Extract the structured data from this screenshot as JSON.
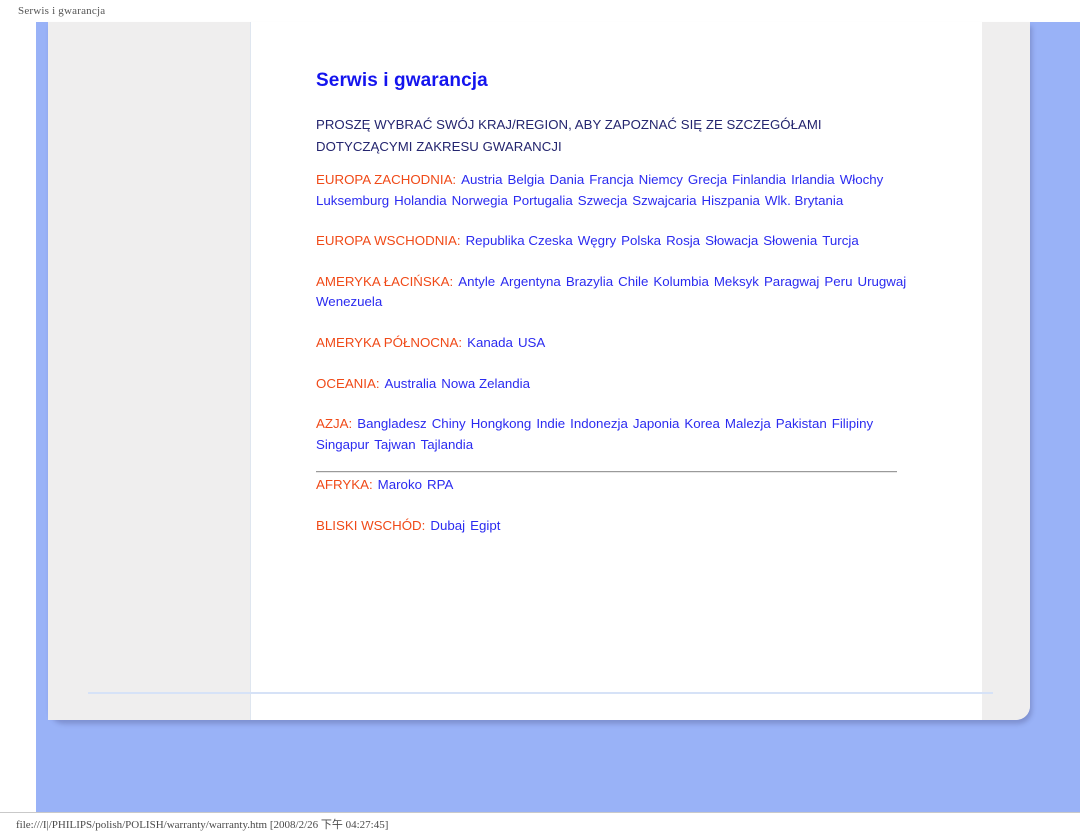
{
  "print_header": "Serwis i gwarancja",
  "document": {
    "title": "Serwis i gwarancja",
    "subtitle": "PROSZĘ WYBRAĆ SWÓJ KRAJ/REGION, ABY ZAPOZNAĆ SIĘ ZE SZCZEGÓŁAMI DOTYCZĄCYMI ZAKRESU GWARANCJI",
    "regions": [
      {
        "label": "EUROPA ZACHODNIA:",
        "countries": [
          "Austria",
          "Belgia",
          "Dania",
          "Francja",
          "Niemcy",
          "Grecja",
          "Finlandia",
          "Irlandia",
          "Włochy",
          "Luksemburg",
          "Holandia",
          "Norwegia",
          "Portugalia",
          "Szwecja",
          "Szwajcaria",
          "Hiszpania",
          "Wlk. Brytania"
        ]
      },
      {
        "label": "EUROPA WSCHODNIA:",
        "countries": [
          "Republika Czeska",
          "Węgry",
          "Polska",
          "Rosja",
          "Słowacja",
          "Słowenia",
          "Turcja"
        ]
      },
      {
        "label": "AMERYKA ŁACIŃSKA:",
        "countries": [
          "Antyle",
          "Argentyna",
          "Brazylia",
          "Chile",
          "Kolumbia",
          "Meksyk",
          "Paragwaj",
          "Peru",
          "Urugwaj",
          "Wenezuela"
        ]
      },
      {
        "label": "AMERYKA PÓŁNOCNA:",
        "countries": [
          "Kanada",
          "USA"
        ]
      },
      {
        "label": "OCEANIA:",
        "countries": [
          "Australia",
          "Nowa Zelandia"
        ]
      },
      {
        "label": "AZJA:",
        "countries": [
          "Bangladesz",
          "Chiny",
          "Hongkong",
          "Indie",
          "Indonezja",
          "Japonia",
          "Korea",
          "Malezja",
          "Pakistan",
          "Filipiny",
          "Singapur",
          "Tajwan",
          "Tajlandia"
        ]
      },
      {
        "label": "AFRYKA:",
        "countries": [
          "Maroko",
          "RPA"
        ]
      },
      {
        "label": "BLISKI WSCHÓD:",
        "countries": [
          "Dubaj",
          "Egipt"
        ]
      }
    ]
  },
  "status_bar": {
    "text": "file:///I|/PHILIPS/polish/POLISH/warranty/warranty.htm [2008/2/26 下午 04:27:45]"
  },
  "colors": {
    "title_blue": "#1414ee",
    "link_blue": "#2b2bf0",
    "region_label_orange": "#f04a18",
    "subtitle_navy": "#23246e",
    "canvas_blue": "#99b2f7",
    "sheet_gray": "#efeeee"
  }
}
